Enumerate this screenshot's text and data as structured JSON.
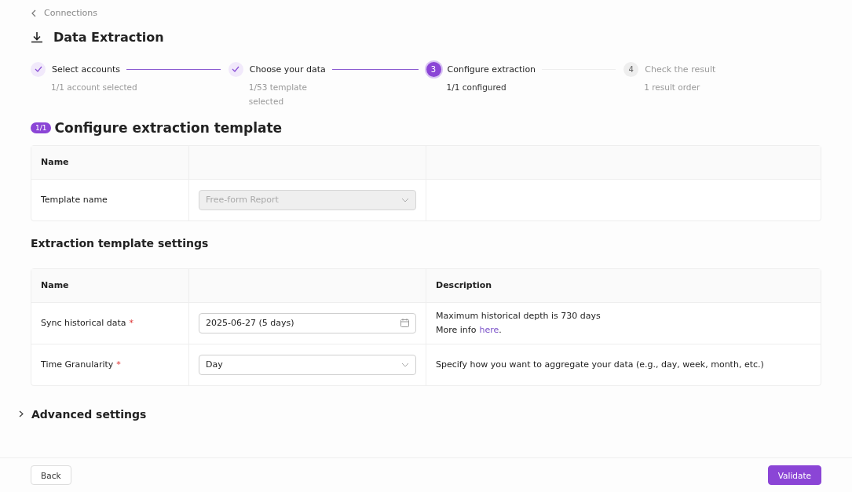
{
  "breadcrumb": {
    "label": "Connections"
  },
  "page_title": "Data Extraction",
  "steps": [
    {
      "title": "Select accounts",
      "subtitle": "1/1 account selected",
      "done": true,
      "selected": false
    },
    {
      "title": "Choose your data",
      "subtitle": "1/53 template selected",
      "done": true,
      "selected": false
    },
    {
      "number": "3",
      "title": "Configure extraction",
      "subtitle": "1/1 configured",
      "done": false,
      "selected": true
    },
    {
      "number": "4",
      "title": "Check the result",
      "subtitle": "1 result order",
      "done": false,
      "selected": false
    }
  ],
  "template_section": {
    "badge": "1/1",
    "title": "Configure extraction template",
    "table": {
      "columns": [
        "Name"
      ],
      "rows": [
        {
          "label": "Template name",
          "field": {
            "placeholder": "Free-form Report",
            "disabled": true,
            "kind": "select"
          }
        }
      ]
    }
  },
  "settings_section": {
    "title": "Extraction template settings",
    "table": {
      "columns": [
        "Name",
        "Description"
      ],
      "rows": [
        {
          "label": "Sync historical data",
          "required_mark": "*",
          "field": {
            "value": "2025-06-27 (5 days)",
            "disabled": false,
            "kind": "date"
          },
          "description": [
            {
              "text": "Maximum historical depth is 730 days"
            },
            {
              "text": "More info",
              "link": "here",
              "after": "."
            }
          ]
        },
        {
          "label": "Time Granularity",
          "required_mark": "*",
          "field": {
            "value": "Day",
            "disabled": false,
            "kind": "select"
          },
          "description": [
            {
              "text": "Specify how you want to aggregate your data (e.g., day, week, month, etc.)"
            }
          ]
        }
      ]
    }
  },
  "advanced": {
    "title": "Advanced settings",
    "expanded": false
  },
  "footer": {
    "back": "Back",
    "validate": "Validate"
  }
}
